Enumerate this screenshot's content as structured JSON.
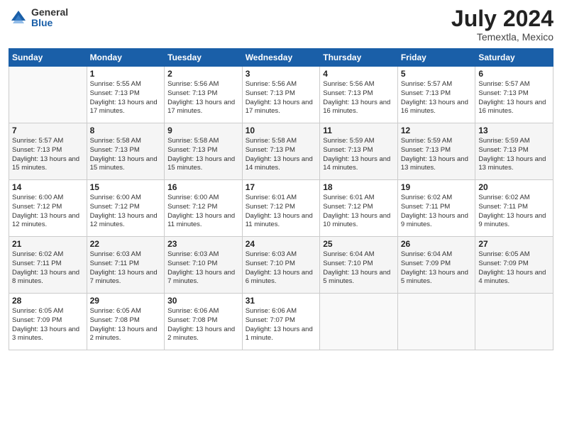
{
  "logo": {
    "general": "General",
    "blue": "Blue"
  },
  "header": {
    "month_year": "July 2024",
    "location": "Temextla, Mexico"
  },
  "days_of_week": [
    "Sunday",
    "Monday",
    "Tuesday",
    "Wednesday",
    "Thursday",
    "Friday",
    "Saturday"
  ],
  "weeks": [
    [
      {
        "num": "",
        "sunrise": "",
        "sunset": "",
        "daylight": "",
        "empty": true
      },
      {
        "num": "1",
        "sunrise": "Sunrise: 5:55 AM",
        "sunset": "Sunset: 7:13 PM",
        "daylight": "Daylight: 13 hours and 17 minutes."
      },
      {
        "num": "2",
        "sunrise": "Sunrise: 5:56 AM",
        "sunset": "Sunset: 7:13 PM",
        "daylight": "Daylight: 13 hours and 17 minutes."
      },
      {
        "num": "3",
        "sunrise": "Sunrise: 5:56 AM",
        "sunset": "Sunset: 7:13 PM",
        "daylight": "Daylight: 13 hours and 17 minutes."
      },
      {
        "num": "4",
        "sunrise": "Sunrise: 5:56 AM",
        "sunset": "Sunset: 7:13 PM",
        "daylight": "Daylight: 13 hours and 16 minutes."
      },
      {
        "num": "5",
        "sunrise": "Sunrise: 5:57 AM",
        "sunset": "Sunset: 7:13 PM",
        "daylight": "Daylight: 13 hours and 16 minutes."
      },
      {
        "num": "6",
        "sunrise": "Sunrise: 5:57 AM",
        "sunset": "Sunset: 7:13 PM",
        "daylight": "Daylight: 13 hours and 16 minutes."
      }
    ],
    [
      {
        "num": "7",
        "sunrise": "Sunrise: 5:57 AM",
        "sunset": "Sunset: 7:13 PM",
        "daylight": "Daylight: 13 hours and 15 minutes."
      },
      {
        "num": "8",
        "sunrise": "Sunrise: 5:58 AM",
        "sunset": "Sunset: 7:13 PM",
        "daylight": "Daylight: 13 hours and 15 minutes."
      },
      {
        "num": "9",
        "sunrise": "Sunrise: 5:58 AM",
        "sunset": "Sunset: 7:13 PM",
        "daylight": "Daylight: 13 hours and 15 minutes."
      },
      {
        "num": "10",
        "sunrise": "Sunrise: 5:58 AM",
        "sunset": "Sunset: 7:13 PM",
        "daylight": "Daylight: 13 hours and 14 minutes."
      },
      {
        "num": "11",
        "sunrise": "Sunrise: 5:59 AM",
        "sunset": "Sunset: 7:13 PM",
        "daylight": "Daylight: 13 hours and 14 minutes."
      },
      {
        "num": "12",
        "sunrise": "Sunrise: 5:59 AM",
        "sunset": "Sunset: 7:13 PM",
        "daylight": "Daylight: 13 hours and 13 minutes."
      },
      {
        "num": "13",
        "sunrise": "Sunrise: 5:59 AM",
        "sunset": "Sunset: 7:13 PM",
        "daylight": "Daylight: 13 hours and 13 minutes."
      }
    ],
    [
      {
        "num": "14",
        "sunrise": "Sunrise: 6:00 AM",
        "sunset": "Sunset: 7:12 PM",
        "daylight": "Daylight: 13 hours and 12 minutes."
      },
      {
        "num": "15",
        "sunrise": "Sunrise: 6:00 AM",
        "sunset": "Sunset: 7:12 PM",
        "daylight": "Daylight: 13 hours and 12 minutes."
      },
      {
        "num": "16",
        "sunrise": "Sunrise: 6:00 AM",
        "sunset": "Sunset: 7:12 PM",
        "daylight": "Daylight: 13 hours and 11 minutes."
      },
      {
        "num": "17",
        "sunrise": "Sunrise: 6:01 AM",
        "sunset": "Sunset: 7:12 PM",
        "daylight": "Daylight: 13 hours and 11 minutes."
      },
      {
        "num": "18",
        "sunrise": "Sunrise: 6:01 AM",
        "sunset": "Sunset: 7:12 PM",
        "daylight": "Daylight: 13 hours and 10 minutes."
      },
      {
        "num": "19",
        "sunrise": "Sunrise: 6:02 AM",
        "sunset": "Sunset: 7:11 PM",
        "daylight": "Daylight: 13 hours and 9 minutes."
      },
      {
        "num": "20",
        "sunrise": "Sunrise: 6:02 AM",
        "sunset": "Sunset: 7:11 PM",
        "daylight": "Daylight: 13 hours and 9 minutes."
      }
    ],
    [
      {
        "num": "21",
        "sunrise": "Sunrise: 6:02 AM",
        "sunset": "Sunset: 7:11 PM",
        "daylight": "Daylight: 13 hours and 8 minutes."
      },
      {
        "num": "22",
        "sunrise": "Sunrise: 6:03 AM",
        "sunset": "Sunset: 7:11 PM",
        "daylight": "Daylight: 13 hours and 7 minutes."
      },
      {
        "num": "23",
        "sunrise": "Sunrise: 6:03 AM",
        "sunset": "Sunset: 7:10 PM",
        "daylight": "Daylight: 13 hours and 7 minutes."
      },
      {
        "num": "24",
        "sunrise": "Sunrise: 6:03 AM",
        "sunset": "Sunset: 7:10 PM",
        "daylight": "Daylight: 13 hours and 6 minutes."
      },
      {
        "num": "25",
        "sunrise": "Sunrise: 6:04 AM",
        "sunset": "Sunset: 7:10 PM",
        "daylight": "Daylight: 13 hours and 5 minutes."
      },
      {
        "num": "26",
        "sunrise": "Sunrise: 6:04 AM",
        "sunset": "Sunset: 7:09 PM",
        "daylight": "Daylight: 13 hours and 5 minutes."
      },
      {
        "num": "27",
        "sunrise": "Sunrise: 6:05 AM",
        "sunset": "Sunset: 7:09 PM",
        "daylight": "Daylight: 13 hours and 4 minutes."
      }
    ],
    [
      {
        "num": "28",
        "sunrise": "Sunrise: 6:05 AM",
        "sunset": "Sunset: 7:09 PM",
        "daylight": "Daylight: 13 hours and 3 minutes."
      },
      {
        "num": "29",
        "sunrise": "Sunrise: 6:05 AM",
        "sunset": "Sunset: 7:08 PM",
        "daylight": "Daylight: 13 hours and 2 minutes."
      },
      {
        "num": "30",
        "sunrise": "Sunrise: 6:06 AM",
        "sunset": "Sunset: 7:08 PM",
        "daylight": "Daylight: 13 hours and 2 minutes."
      },
      {
        "num": "31",
        "sunrise": "Sunrise: 6:06 AM",
        "sunset": "Sunset: 7:07 PM",
        "daylight": "Daylight: 13 hours and 1 minute."
      },
      {
        "num": "",
        "sunrise": "",
        "sunset": "",
        "daylight": "",
        "empty": true
      },
      {
        "num": "",
        "sunrise": "",
        "sunset": "",
        "daylight": "",
        "empty": true
      },
      {
        "num": "",
        "sunrise": "",
        "sunset": "",
        "daylight": "",
        "empty": true
      }
    ]
  ]
}
